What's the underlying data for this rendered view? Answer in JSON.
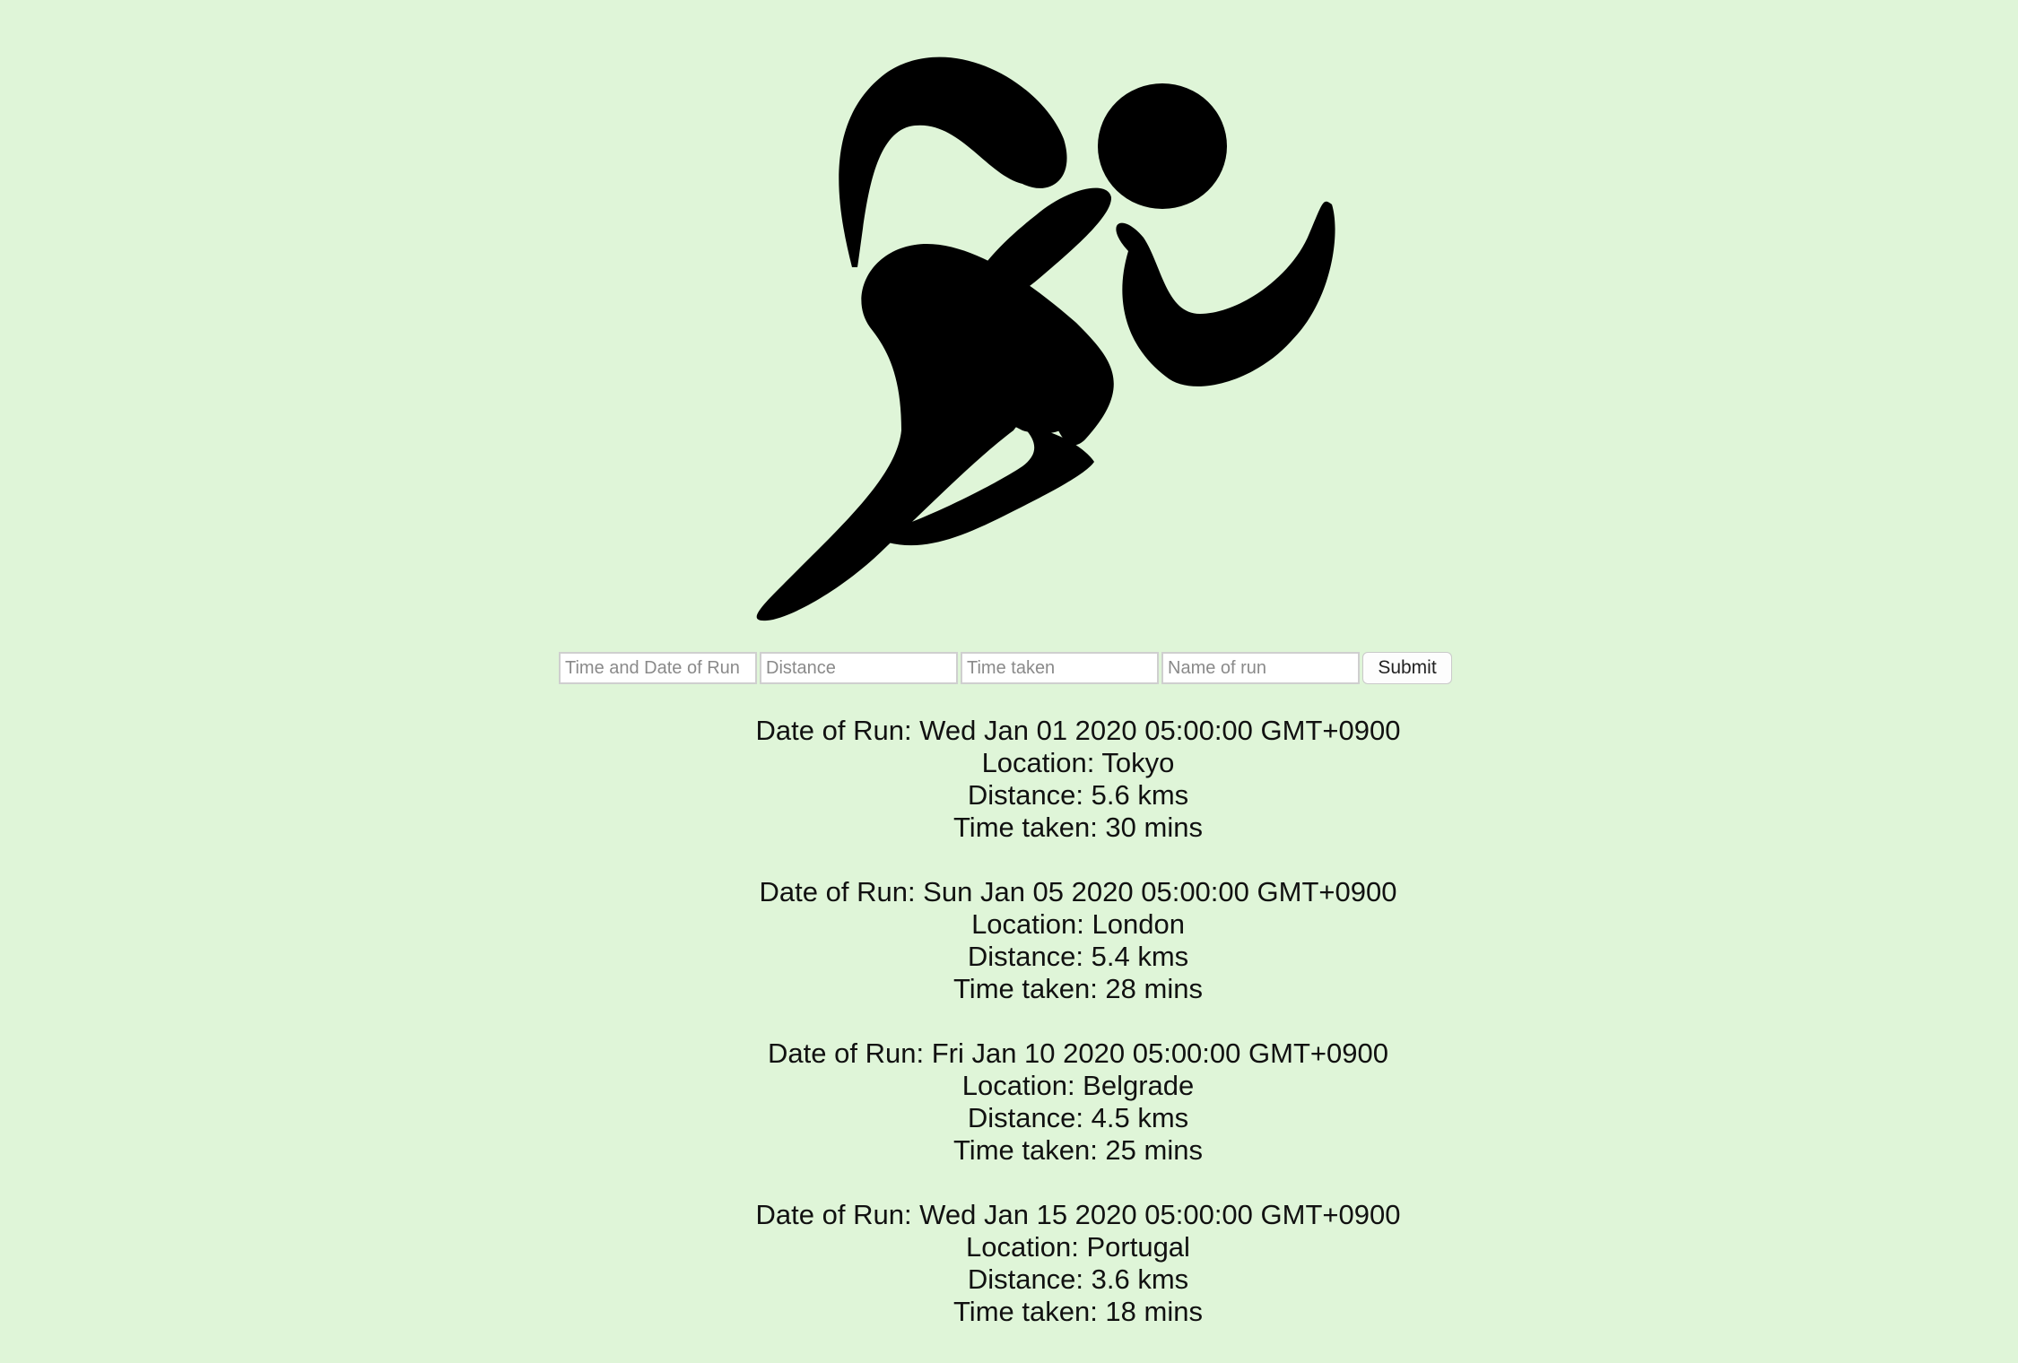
{
  "logo": {
    "icon": "running-person-icon",
    "color": "#000000"
  },
  "background_color": "#dff5d8",
  "form": {
    "datetime_placeholder": "Time and Date of Run",
    "distance_placeholder": "Distance",
    "time_taken_placeholder": "Time taken",
    "name_placeholder": "Name of run",
    "submit_label": "Submit"
  },
  "runs": [
    {
      "date": "Date of Run: Wed Jan 01 2020 05:00:00 GMT+0900",
      "location": "Location: Tokyo",
      "distance": "Distance: 5.6 kms",
      "time_taken": "Time taken: 30 mins"
    },
    {
      "date": "Date of Run: Sun Jan 05 2020 05:00:00 GMT+0900",
      "location": "Location: London",
      "distance": "Distance: 5.4 kms",
      "time_taken": "Time taken: 28 mins"
    },
    {
      "date": "Date of Run: Fri Jan 10 2020 05:00:00 GMT+0900",
      "location": "Location: Belgrade",
      "distance": "Distance: 4.5 kms",
      "time_taken": "Time taken: 25 mins"
    },
    {
      "date": "Date of Run: Wed Jan 15 2020 05:00:00 GMT+0900",
      "location": "Location: Portugal",
      "distance": "Distance: 3.6 kms",
      "time_taken": "Time taken: 18 mins"
    }
  ]
}
